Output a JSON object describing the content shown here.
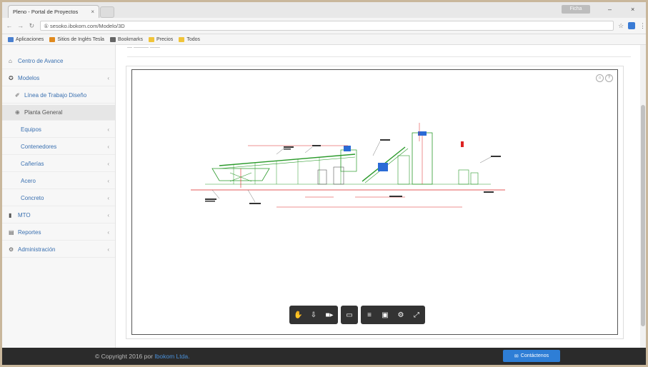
{
  "browser": {
    "tab_title": "Pleno - Portal de Proyectos",
    "tab_close": "×",
    "user_badge": "Ficha",
    "window_min": "–",
    "window_close": "×",
    "back": "←",
    "forward": "→",
    "reload": "↻",
    "url": "① sesoko.ibokom.com/Modelo/3D",
    "star": "☆",
    "menu": "⋮"
  },
  "bookmarks": [
    {
      "label": "Aplicaciones",
      "color": "#4a80d0"
    },
    {
      "label": "Sitios de Inglés Tesla",
      "color": "#e08a1e"
    },
    {
      "label": "Bookmarks",
      "color": "#666666"
    },
    {
      "label": "Precios",
      "color": "#f0c43a"
    },
    {
      "label": "Todos",
      "color": "#f0c43a"
    }
  ],
  "sidebar": {
    "items": [
      {
        "label": "Centro de Avance",
        "icon": "⌂"
      },
      {
        "label": "Modelos",
        "icon": "✪",
        "chevron": "‹"
      },
      {
        "label": "Línea de Trabajo Diseño",
        "icon": "✐"
      },
      {
        "label": "Planta General",
        "icon": "⊕"
      },
      {
        "label": "Equipos",
        "chevron": "‹"
      },
      {
        "label": "Contenedores",
        "chevron": "‹"
      },
      {
        "label": "Cañerías",
        "chevron": "‹"
      },
      {
        "label": "Acero",
        "chevron": "‹"
      },
      {
        "label": "Concreto",
        "chevron": "‹"
      },
      {
        "label": "MTO",
        "icon": "▮",
        "chevron": "‹"
      },
      {
        "label": "Reportes",
        "icon": "▤",
        "chevron": "‹"
      },
      {
        "label": "Administración",
        "icon": "⚙",
        "chevron": "‹"
      }
    ]
  },
  "main": {
    "breadcrumb": "— ——— ——",
    "viewer_icons": [
      "⌂",
      "?"
    ],
    "toolbar": {
      "group1": [
        "✋",
        "⇩",
        "■▸"
      ],
      "group2": [
        "▭"
      ],
      "group3": [
        "≡",
        "▣",
        "⚙",
        "⤢"
      ]
    }
  },
  "footer": {
    "copyright": "© Copyright 2016 por",
    "brand": "Ibokom Ltda.",
    "contact_icon": "✉",
    "contact_label": "Contáctenos"
  }
}
